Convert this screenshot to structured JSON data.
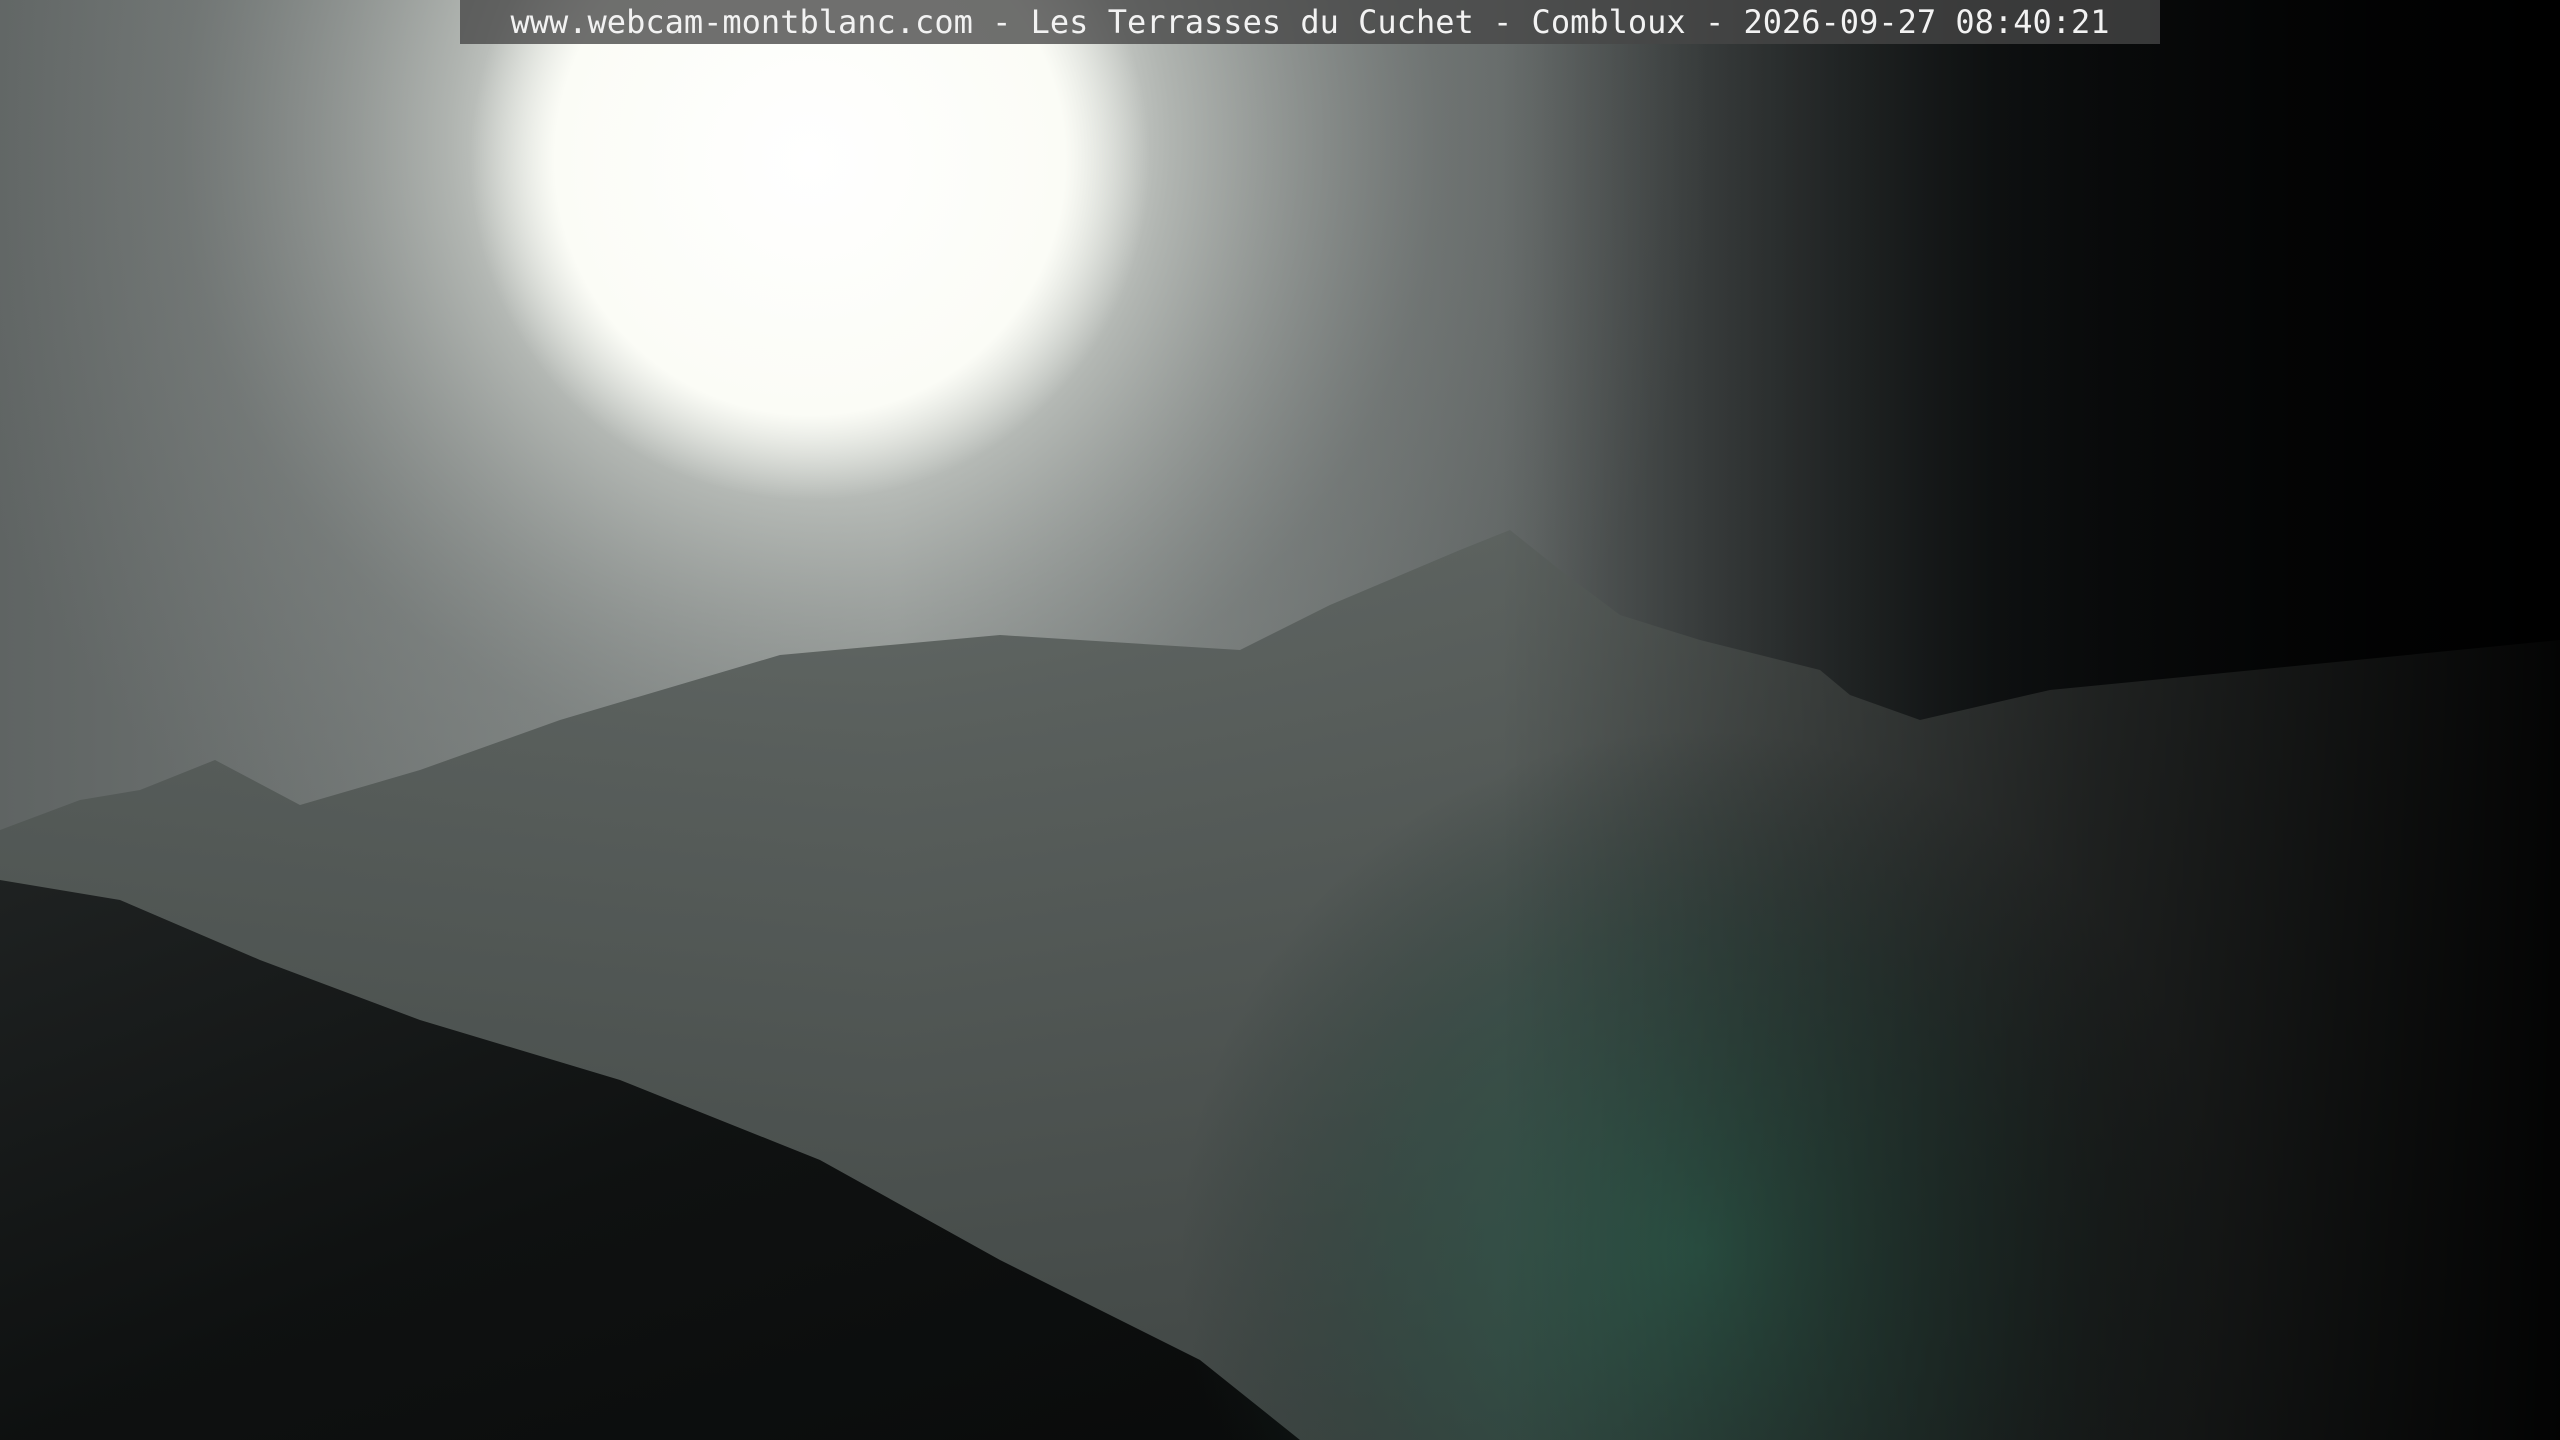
{
  "overlay": {
    "caption": "www.webcam-montblanc.com - Les Terrasses du Cuchet - Combloux - 2026-09-27 08:40:21"
  },
  "scene": {
    "sun_color": "#ffffff",
    "haze_color": "#8e9492",
    "mountain_color": "#4a504d",
    "foreground_color": "#0b0d0d",
    "flare_color": "#2f5a4c"
  }
}
